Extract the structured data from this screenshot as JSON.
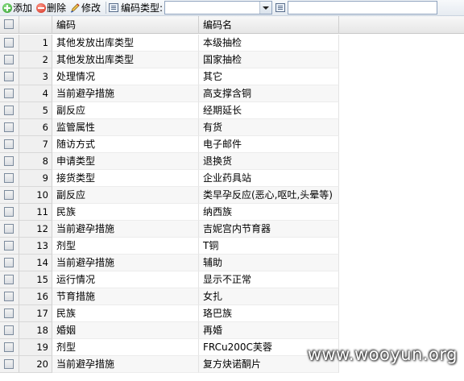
{
  "toolbar": {
    "add_label": "添加",
    "delete_label": "删除",
    "edit_label": "修改",
    "type_label": "编码类型:",
    "type_value": "",
    "search_value": ""
  },
  "grid": {
    "columns": [
      "编码",
      "编码名"
    ],
    "rows": [
      {
        "num": "1",
        "code": "其他发放出库类型",
        "name": "本级抽检"
      },
      {
        "num": "2",
        "code": "其他发放出库类型",
        "name": "国家抽检"
      },
      {
        "num": "3",
        "code": "处理情况",
        "name": "其它"
      },
      {
        "num": "4",
        "code": "当前避孕措施",
        "name": "高支撑含铜"
      },
      {
        "num": "5",
        "code": "副反应",
        "name": "经期延长"
      },
      {
        "num": "6",
        "code": "监管属性",
        "name": "有货"
      },
      {
        "num": "7",
        "code": "随访方式",
        "name": "电子邮件"
      },
      {
        "num": "8",
        "code": "申请类型",
        "name": "退换货"
      },
      {
        "num": "9",
        "code": "接货类型",
        "name": "企业药具站"
      },
      {
        "num": "10",
        "code": "副反应",
        "name": "类早孕反应(恶心,呕吐,头晕等)"
      },
      {
        "num": "11",
        "code": "民族",
        "name": "纳西族"
      },
      {
        "num": "12",
        "code": "当前避孕措施",
        "name": "吉妮宫内节育器"
      },
      {
        "num": "13",
        "code": "剂型",
        "name": "T铜"
      },
      {
        "num": "14",
        "code": "当前避孕措施",
        "name": "辅助"
      },
      {
        "num": "15",
        "code": "运行情况",
        "name": "显示不正常"
      },
      {
        "num": "16",
        "code": "节育措施",
        "name": "女扎"
      },
      {
        "num": "17",
        "code": "民族",
        "name": "珞巴族"
      },
      {
        "num": "18",
        "code": "婚姻",
        "name": "再婚"
      },
      {
        "num": "19",
        "code": "剂型",
        "name": "FRCu200C芙蓉"
      },
      {
        "num": "20",
        "code": "当前避孕措施",
        "name": "复方炔诺酮片"
      }
    ]
  },
  "watermark": "www.wooyun.org",
  "icons": {
    "add": "add-icon",
    "delete": "delete-icon",
    "edit": "edit-icon",
    "type": "list-icon"
  }
}
